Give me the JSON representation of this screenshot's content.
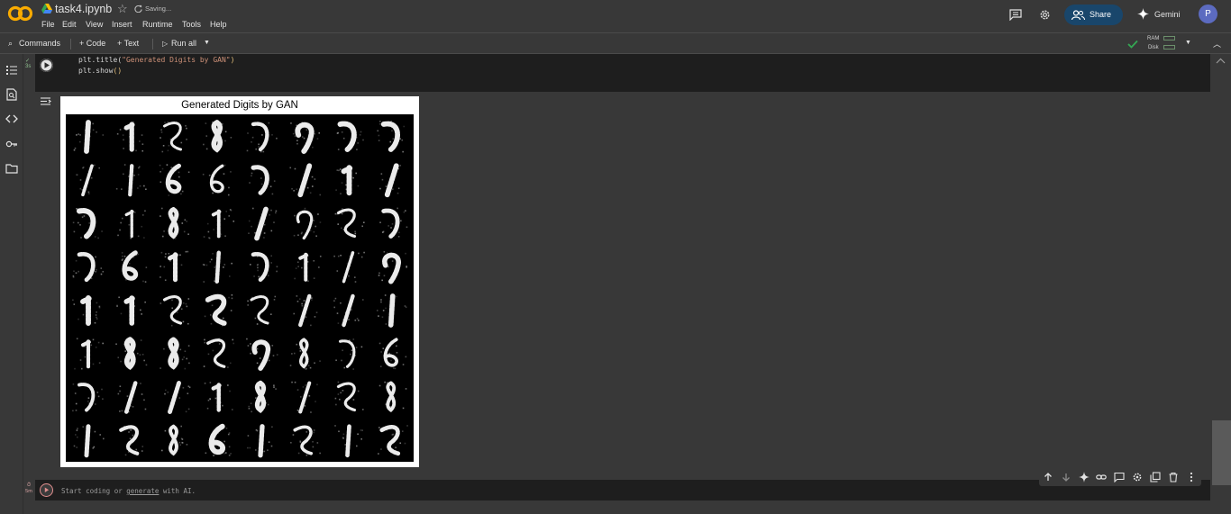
{
  "header": {
    "title": "task4.ipynb",
    "saving": "Saving...",
    "menus": [
      "File",
      "Edit",
      "View",
      "Insert",
      "Runtime",
      "Tools",
      "Help"
    ],
    "share_label": "Share",
    "gemini_label": "Gemini",
    "avatar_letter": "P"
  },
  "toolbar": {
    "commands": "Commands",
    "code": "+ Code",
    "text": "+ Text",
    "run_all": "Run all",
    "ram": "RAM",
    "disk": "Disk"
  },
  "cell1": {
    "status": "3s",
    "lines": [
      {
        "pre": "plt.title(",
        "str": "\"Generated Digits by GAN\"",
        "post": ")"
      },
      {
        "pre": "plt.show",
        "str": "",
        "post": "()"
      }
    ]
  },
  "output": {
    "figure_title": "Generated Digits by GAN"
  },
  "cell2": {
    "status": "5m",
    "placeholder_pre": "Start coding or ",
    "placeholder_link": "generate",
    "placeholder_post": " with AI."
  },
  "colors": {
    "accent_share": "#19466b",
    "avatar": "#5c6bc0",
    "check": "#34a853"
  }
}
